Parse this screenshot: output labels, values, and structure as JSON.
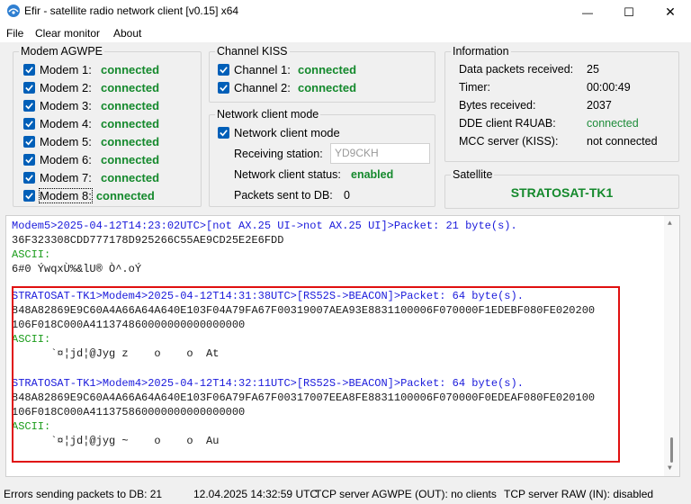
{
  "window": {
    "title": "Efir - satellite radio network client [v0.15] x64",
    "min_glyph": "—",
    "max_glyph": "☐",
    "close_glyph": "✕"
  },
  "menu": {
    "file": "File",
    "clear_monitor": "Clear monitor",
    "about": "About"
  },
  "modem_agwpe": {
    "legend": "Modem AGWPE",
    "items": [
      {
        "label": "Modem 1:",
        "status": "connected"
      },
      {
        "label": "Modem 2:",
        "status": "connected"
      },
      {
        "label": "Modem 3:",
        "status": "connected"
      },
      {
        "label": "Modem 4:",
        "status": "connected"
      },
      {
        "label": "Modem 5:",
        "status": "connected"
      },
      {
        "label": "Modem 6:",
        "status": "connected"
      },
      {
        "label": "Modem 7:",
        "status": "connected"
      },
      {
        "label": "Modem 8:",
        "status": "connected"
      }
    ]
  },
  "channel_kiss": {
    "legend": "Channel KISS",
    "items": [
      {
        "label": "Channel 1:",
        "status": "connected"
      },
      {
        "label": "Channel 2:",
        "status": "connected"
      }
    ]
  },
  "network_client_mode": {
    "legend": "Network client mode",
    "checkbox_label": "Network client mode",
    "receiving_station_label": "Receiving station:",
    "receiving_station_value": "YD9CKH",
    "status_label": "Network client status:",
    "status_value": "enabled",
    "packets_label": "Packets sent to DB:",
    "packets_value": "0"
  },
  "information": {
    "legend": "Information",
    "rows": [
      {
        "label": "Data packets received:",
        "value": "25"
      },
      {
        "label": "Timer:",
        "value": "00:00:49"
      },
      {
        "label": "Bytes received:",
        "value": "2037"
      },
      {
        "label": "DDE client R4UAB:",
        "value": "connected"
      },
      {
        "label": "MCC server (KISS):",
        "value": "not connected"
      }
    ]
  },
  "satellite": {
    "legend": "Satellite",
    "name": "STRATOSAT-TK1"
  },
  "log": {
    "lines": [
      "Modem5>2025-04-12T14:23:02UTC>[not AX.25 UI->not AX.25 UI]>Packet: 21 byte(s).",
      "36F323308CDD777178D925266C55AE9CD25E2E6FDD",
      "ASCII:",
      "6#0 ÝwqxÙ%&lU® Ò^.oÝ",
      "STRATOSAT-TK1>Modem4>2025-04-12T14:31:38UTC>[RS52S->BEACON]>Packet: 64 byte(s).",
      "848A82869E9C60A4A66A64A640E103F04A79FA67F00319007AEA93E8831100006F070000F1EDEBF080FE020200",
      "106F018C000A411374860000000000000000",
      "ASCII:",
      "      `¤¦jd¦@Jyg z    o    o  At",
      "STRATOSAT-TK1>Modem4>2025-04-12T14:32:11UTC>[RS52S->BEACON]>Packet: 64 byte(s).",
      "848A82869E9C60A4A66A64A640E103F06A79FA67F00317007EEA8FE8831100006F070000F0EDEAF080FE020100",
      "106F018C000A411375860000000000000000",
      "ASCII:",
      "      `¤¦jd¦@jyg ~    o    o  Au"
    ]
  },
  "statusbar": {
    "errors": "Errors sending packets to DB: 21",
    "datetime": "12.04.2025 14:32:59 UTC",
    "agwpe_server": "TCP server AGWPE (OUT): no clients",
    "raw_server": "TCP server RAW (IN): disabled"
  },
  "colors": {
    "accent": "#005fb8",
    "connected_green": "#14892c",
    "log_header_blue": "#1a1adb",
    "log_ascii_green": "#1a9c1a",
    "highlight_red": "#e01010"
  }
}
